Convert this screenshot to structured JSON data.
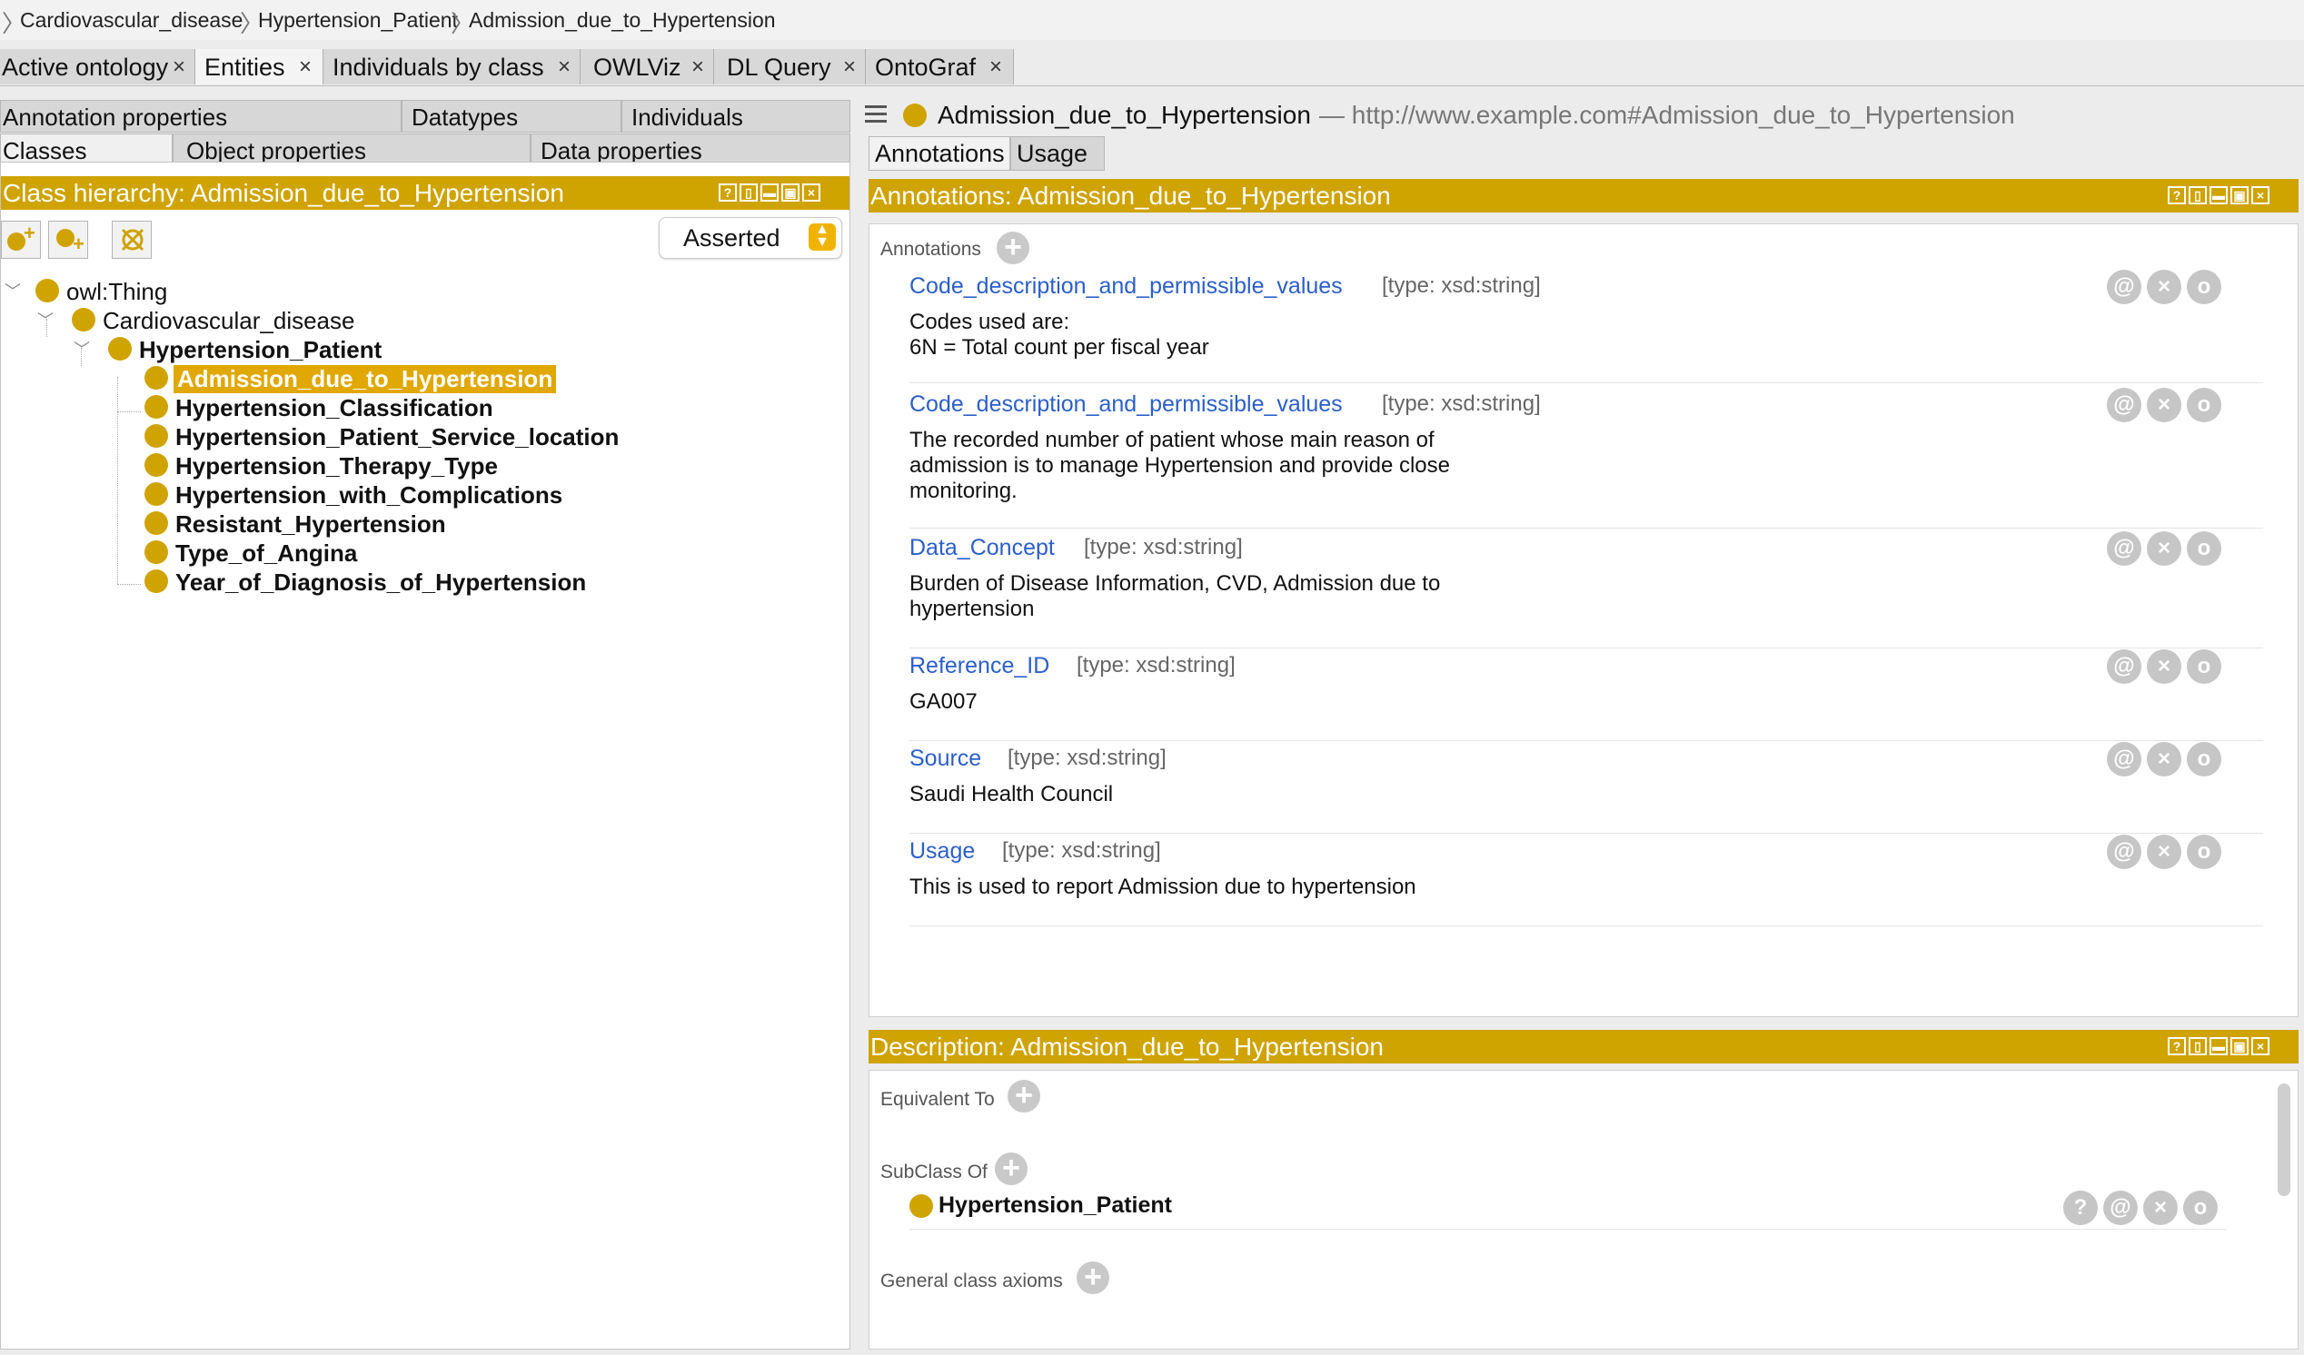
{
  "breadcrumb": [
    "Cardiovascular_disease",
    "Hypertension_Patient",
    "Admission_due_to_Hypertension"
  ],
  "tabs": [
    {
      "label": "Active ontology",
      "active": false
    },
    {
      "label": "Entities",
      "active": true
    },
    {
      "label": "Individuals by class",
      "active": false
    },
    {
      "label": "OWLViz",
      "active": false
    },
    {
      "label": "DL Query",
      "active": false
    },
    {
      "label": "OntoGraf",
      "active": false
    }
  ],
  "tab_close": "×",
  "left_subtabs": {
    "row1": [
      "Annotation properties",
      "Datatypes",
      "Individuals"
    ],
    "row2": [
      "Classes",
      "Object properties",
      "Data properties"
    ]
  },
  "class_hierarchy": {
    "title": "Class hierarchy: Admission_due_to_Hypertension",
    "mode": "Asserted",
    "tree": [
      {
        "label": "owl:Thing"
      },
      {
        "label": "Cardiovascular_disease"
      },
      {
        "label": "Hypertension_Patient"
      },
      {
        "label": "Admission_due_to_Hypertension"
      },
      {
        "label": "Hypertension_Classification"
      },
      {
        "label": "Hypertension_Patient_Service_location"
      },
      {
        "label": "Hypertension_Therapy_Type"
      },
      {
        "label": "Hypertension_with_Complications"
      },
      {
        "label": "Resistant_Hypertension"
      },
      {
        "label": "Type_of_Angina"
      },
      {
        "label": "Year_of_Diagnosis_of_Hypertension"
      }
    ]
  },
  "entity": {
    "name": "Admission_due_to_Hypertension",
    "iri": "— http://www.example.com#Admission_due_to_Hypertension"
  },
  "right_tabs": [
    "Annotations",
    "Usage"
  ],
  "annotations_panel": {
    "title": "Annotations: Admission_due_to_Hypertension",
    "section_label": "Annotations",
    "items": [
      {
        "property": "Code_description_and_permissible_values",
        "type": "[type: xsd:string]",
        "value": "Codes used are:\n6N = Total count per fiscal year"
      },
      {
        "property": "Code_description_and_permissible_values",
        "type": "[type: xsd:string]",
        "value": "The recorded number of patient whose main reason of\nadmission is to manage Hypertension and provide close\nmonitoring."
      },
      {
        "property": "Data_Concept",
        "type": "[type: xsd:string]",
        "value": "Burden of Disease Information, CVD, Admission due to\nhypertension"
      },
      {
        "property": "Reference_ID",
        "type": "[type: xsd:string]",
        "value": "GA007"
      },
      {
        "property": "Source",
        "type": "[type: xsd:string]",
        "value": "Saudi Health Council"
      },
      {
        "property": "Usage",
        "type": "[type: xsd:string]",
        "value": "This is used to report Admission due to hypertension"
      }
    ],
    "row_buttons": [
      "@",
      "×",
      "o"
    ]
  },
  "description_panel": {
    "title": "Description: Admission_due_to_Hypertension",
    "equivalent_to": "Equivalent To",
    "subclass_of": "SubClass Of",
    "subclass_value": "Hypertension_Patient",
    "general_axioms": "General class axioms",
    "row_buttons": [
      "?",
      "@",
      "×",
      "o"
    ]
  },
  "panel_controls": [
    "?",
    "▯",
    "▬",
    "▣",
    "×"
  ],
  "colors": {
    "gold": "#cfa300",
    "link": "#2b5fc9",
    "selected": "#e0a800"
  }
}
